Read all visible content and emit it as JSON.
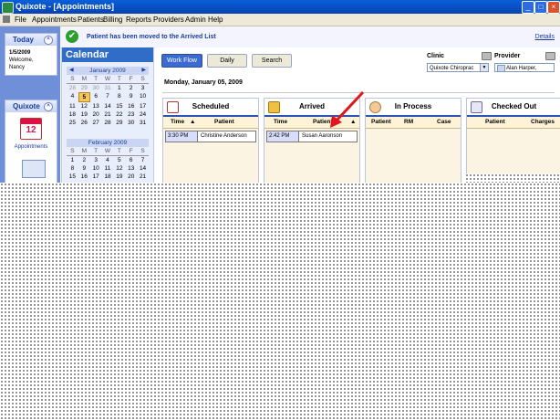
{
  "window": {
    "title": "Quixote - [Appointments]"
  },
  "menu": [
    "File",
    "Appointments",
    "Patients",
    "Billing",
    "Reports",
    "Providers",
    "Admin",
    "Help"
  ],
  "notice": {
    "message": "Patient has been moved to the Arrived List",
    "details_link": "Details"
  },
  "today_panel": {
    "header": "Today",
    "date": "1/5/2009",
    "welcome": "Welcome,",
    "user": "Nancy"
  },
  "quixote_panel": {
    "header": "Quixote",
    "appointments_label": "Appointments",
    "appointments_number": "12"
  },
  "calendar": {
    "title": "Calendar",
    "days_of_week": [
      "S",
      "M",
      "T",
      "W",
      "T",
      "F",
      "S"
    ],
    "months": [
      {
        "name": "January 2009",
        "weeks": [
          [
            "28",
            "29",
            "30",
            "31",
            "1",
            "2",
            "3"
          ],
          [
            "4",
            "5",
            "6",
            "7",
            "8",
            "9",
            "10"
          ],
          [
            "11",
            "12",
            "13",
            "14",
            "15",
            "16",
            "17"
          ],
          [
            "18",
            "19",
            "20",
            "21",
            "22",
            "23",
            "24"
          ],
          [
            "25",
            "26",
            "27",
            "28",
            "29",
            "30",
            "31"
          ]
        ],
        "selected": "5"
      },
      {
        "name": "February 2009",
        "weeks": [
          [
            "1",
            "2",
            "3",
            "4",
            "5",
            "6",
            "7"
          ],
          [
            "8",
            "9",
            "10",
            "11",
            "12",
            "13",
            "14"
          ],
          [
            "15",
            "16",
            "17",
            "18",
            "19",
            "20",
            "21"
          ]
        ]
      }
    ]
  },
  "toolbar": {
    "workflow_label": "Work Flow",
    "daily_label": "Daily",
    "search_label": "Search"
  },
  "clinic": {
    "label": "Clinic",
    "value": "Quixote Chiroprac"
  },
  "provider": {
    "label": "Provider",
    "value": "Alan Harper,"
  },
  "date_header": "Monday, January 05, 2009",
  "columns": {
    "scheduled": {
      "title": "Scheduled",
      "headers": [
        "Time",
        "Patient"
      ],
      "rows": [
        {
          "time": "3:30 PM",
          "patient": "Christine Anderson"
        }
      ]
    },
    "arrived": {
      "title": "Arrived",
      "headers": [
        "Time",
        "Patient"
      ],
      "rows": [
        {
          "time": "2:42 PM",
          "patient": "Susan Aaronson"
        }
      ]
    },
    "in_process": {
      "title": "In Process",
      "headers": [
        "Patient",
        "RM",
        "Case"
      ]
    },
    "checked_out": {
      "title": "Checked Out",
      "headers": [
        "Patient",
        "Charges"
      ]
    }
  }
}
